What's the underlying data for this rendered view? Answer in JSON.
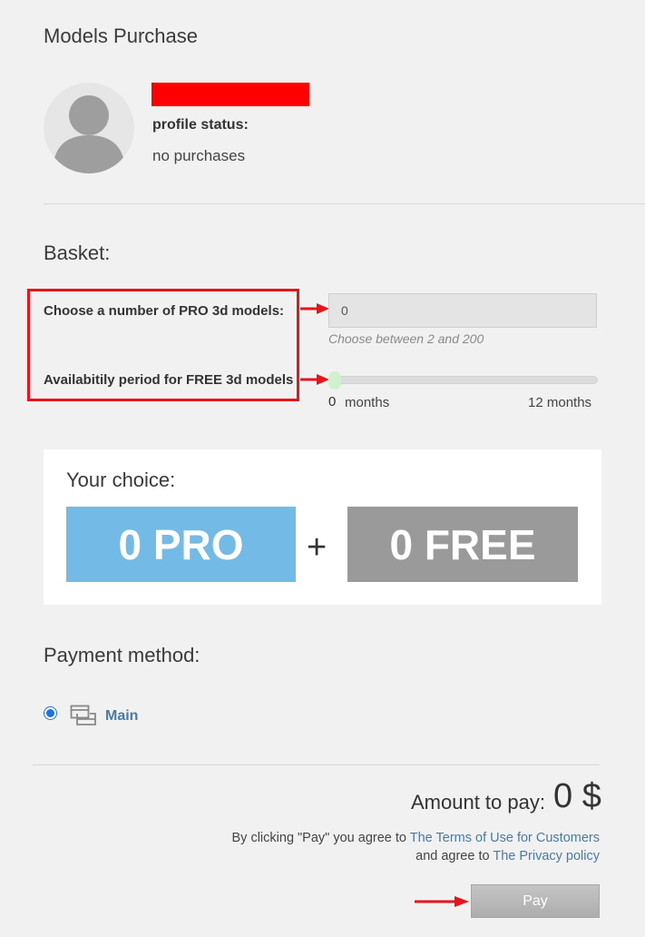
{
  "header": {
    "title": "Models Purchase"
  },
  "profile": {
    "status_label": "profile status:",
    "status_value": "no purchases",
    "redaction_color": "#ff0000"
  },
  "basket": {
    "title": "Basket:",
    "pro_label": "Choose a number of PRO 3d models:",
    "pro_value": "0",
    "pro_hint": "Choose between 2 and 200",
    "free_label": "Availabitily period for FREE 3d models",
    "slider_value": "0",
    "slider_unit": "months",
    "slider_max_label": "12 months",
    "slider_fraction": 0,
    "highlight_color": "#e8141c"
  },
  "choice": {
    "title": "Your choice:",
    "pro_text": "0 PRO",
    "plus": "+",
    "free_text": "0 FREE",
    "pro_color": "#73bae6",
    "free_color": "#9a9a9a"
  },
  "payment": {
    "title": "Payment method:",
    "method_label": "Main",
    "method_icon": "card-stack-icon",
    "method_selected": true
  },
  "summary": {
    "amount_label": "Amount to pay:",
    "amount_value": "0 $",
    "terms_prefix": "By clicking \"Pay\" you agree to",
    "terms_link": "The Terms of Use for Customers",
    "privacy_prefix": "and agree to",
    "privacy_link": "The Privacy policy",
    "pay_label": "Pay"
  },
  "annotations": {
    "arrow_color": "#e8141c"
  }
}
